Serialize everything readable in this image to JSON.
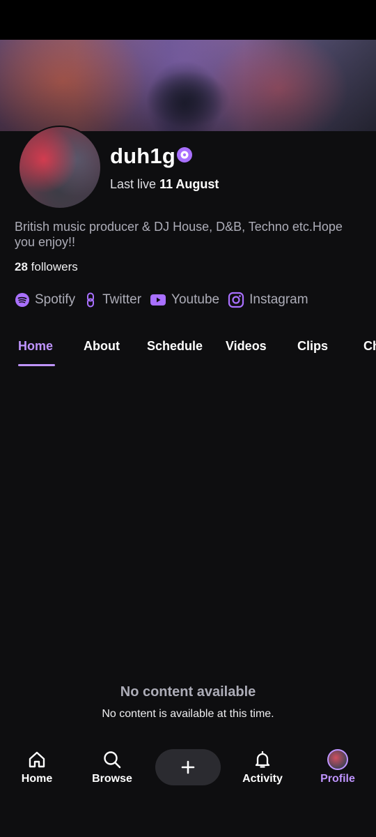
{
  "channel": {
    "name": "duh1g",
    "last_live_label": "Last live",
    "last_live_date": "11 August",
    "bio": "British music producer & DJ House, D&B, Techno etc.Hope you enjoy!!",
    "followers_count": "28",
    "followers_label": "followers"
  },
  "socials": [
    {
      "label": "Spotify",
      "icon": "spotify-icon"
    },
    {
      "label": "Twitter",
      "icon": "link-icon"
    },
    {
      "label": "Youtube",
      "icon": "youtube-icon"
    },
    {
      "label": "Instagram",
      "icon": "instagram-icon"
    }
  ],
  "tabs": [
    {
      "label": "Home",
      "active": true
    },
    {
      "label": "About"
    },
    {
      "label": "Schedule"
    },
    {
      "label": "Videos"
    },
    {
      "label": "Clips"
    },
    {
      "label": "Ch"
    }
  ],
  "empty_state": {
    "title": "No content available",
    "subtitle": "No content is available at this time."
  },
  "bottom_nav": [
    {
      "label": "Home",
      "icon": "home-icon"
    },
    {
      "label": "Browse",
      "icon": "search-icon"
    },
    {
      "label": "",
      "icon": "plus-icon"
    },
    {
      "label": "Activity",
      "icon": "bell-icon"
    },
    {
      "label": "Profile",
      "icon": "avatar",
      "active": true
    }
  ],
  "colors": {
    "accent": "#bf94ff",
    "background": "#0e0e10",
    "muted_text": "#adadb8"
  }
}
